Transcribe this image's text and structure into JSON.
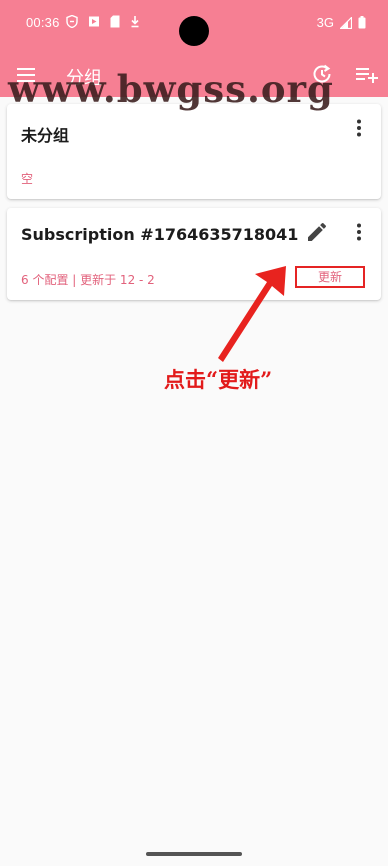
{
  "status_bar": {
    "time": "00:36",
    "network": "3G"
  },
  "toolbar": {
    "title": "分组",
    "menu_icon": "menu-icon",
    "history_icon": "history-icon",
    "add_icon": "playlist-add-icon"
  },
  "watermark": "www.bwgss.org",
  "groups": [
    {
      "name": "未分组",
      "detail": "空"
    },
    {
      "name": "Subscription #1764635718041",
      "detail": "6 个配置 | 更新于 12 - 2",
      "update_label": "更新"
    }
  ],
  "annotation": "点击“更新”",
  "colors": {
    "primary": "#f67f93",
    "accent_text": "#e2627c",
    "highlight_red": "#e52424"
  }
}
